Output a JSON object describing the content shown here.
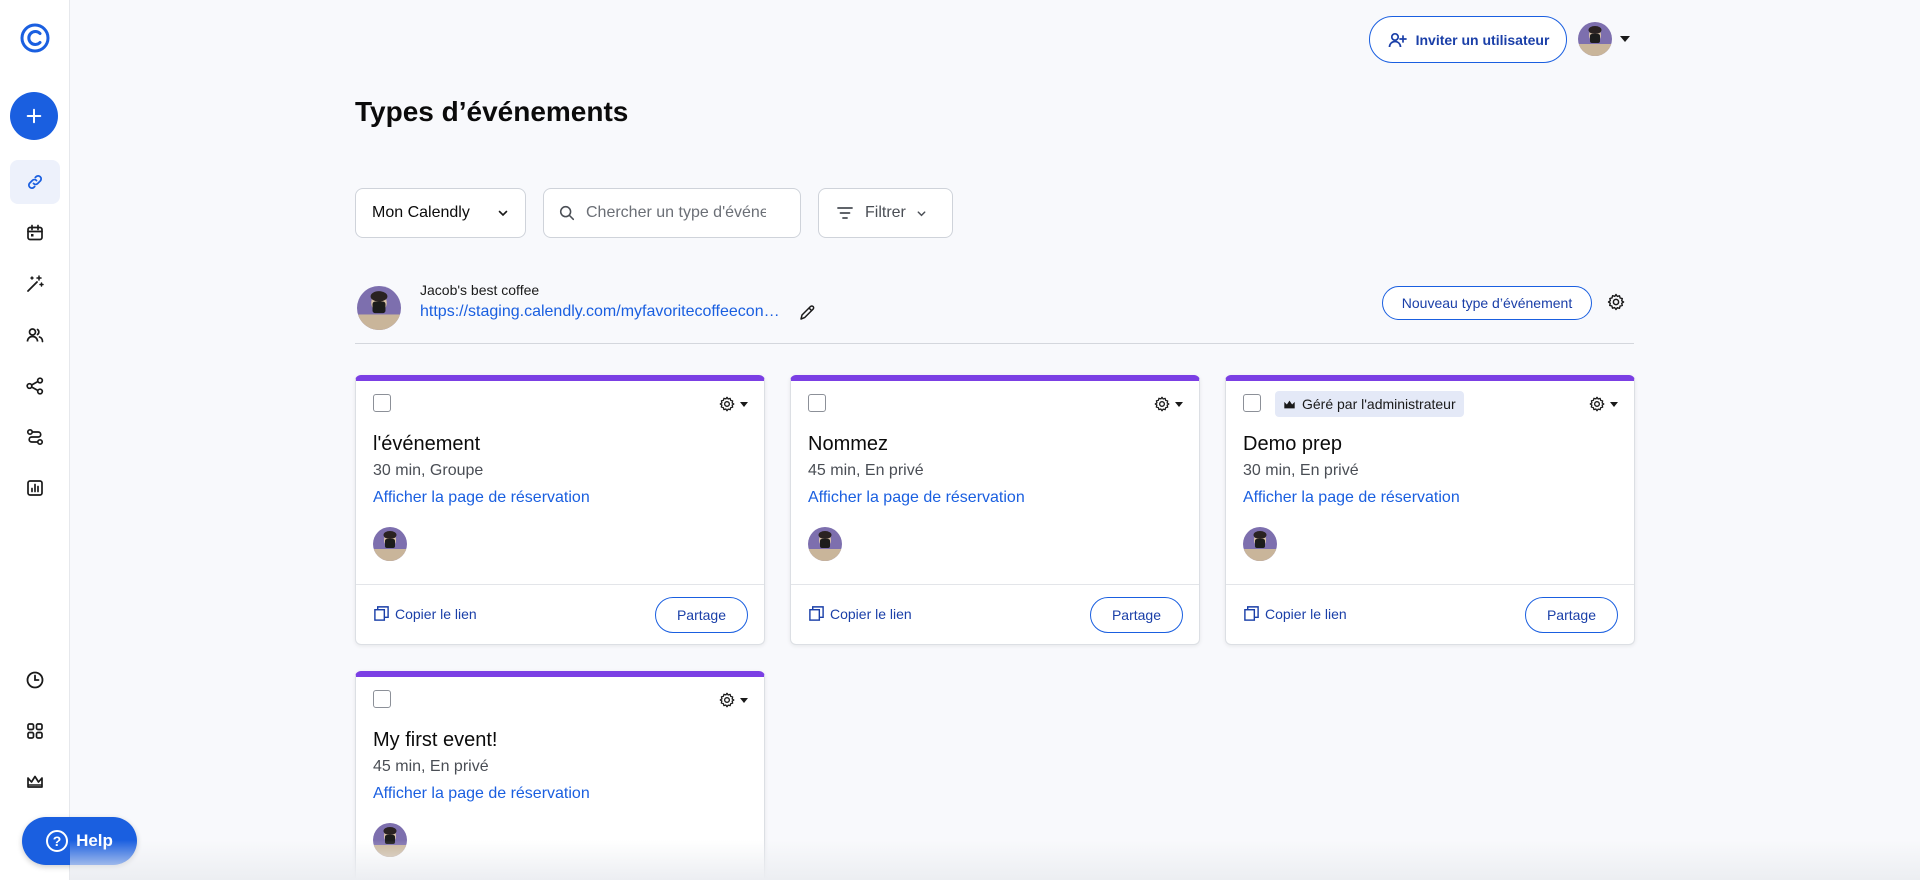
{
  "header": {
    "invite_label": "Inviter un utilisateur",
    "user_avatar": "user-avatar"
  },
  "sidebar": {
    "items": [
      {
        "name": "event-types",
        "icon": "link-icon",
        "active": true
      },
      {
        "name": "meetings",
        "icon": "calendar-icon"
      },
      {
        "name": "workflows",
        "icon": "magic-wand-icon"
      },
      {
        "name": "contacts",
        "icon": "contacts-icon"
      },
      {
        "name": "integrations",
        "icon": "integrations-icon"
      },
      {
        "name": "routing",
        "icon": "routing-icon"
      },
      {
        "name": "analytics",
        "icon": "analytics-icon"
      },
      {
        "name": "availability",
        "icon": "clock-icon"
      },
      {
        "name": "apps",
        "icon": "apps-grid-icon"
      },
      {
        "name": "admin",
        "icon": "crown-icon"
      }
    ],
    "help_label": "Help"
  },
  "page": {
    "title": "Types d’événements"
  },
  "controls": {
    "calendar_select": "Mon Calendly",
    "search_placeholder": "Chercher un type d'événement",
    "filter_label": "Filtrer"
  },
  "owner": {
    "name": "Jacob's best coffee",
    "url": "https://staging.calendly.com/myfavoritecoffeeconsultations",
    "new_event_label": "Nouveau type d’événement"
  },
  "cards": [
    {
      "title": "l'événement",
      "meta": "30 min, Groupe",
      "link": "Afficher la page de réservation",
      "copy": "Copier le lien",
      "share": "Partage",
      "badge": ""
    },
    {
      "title": "Nommez",
      "meta": "45 min, En privé",
      "link": "Afficher la page de réservation",
      "copy": "Copier le lien",
      "share": "Partage",
      "badge": ""
    },
    {
      "title": "Demo prep",
      "meta": "30 min, En privé",
      "link": "Afficher la page de réservation",
      "copy": "Copier le lien",
      "share": "Partage",
      "badge": "Géré par l'administrateur"
    },
    {
      "title": "My first event!",
      "meta": "45 min, En privé",
      "link": "Afficher la page de réservation",
      "copy": "Copier le lien",
      "share": "Partage",
      "badge": ""
    }
  ],
  "colors": {
    "primary": "#1a5fe0",
    "card_accent": "#7b3fe4",
    "background": "#f8f9fc"
  }
}
